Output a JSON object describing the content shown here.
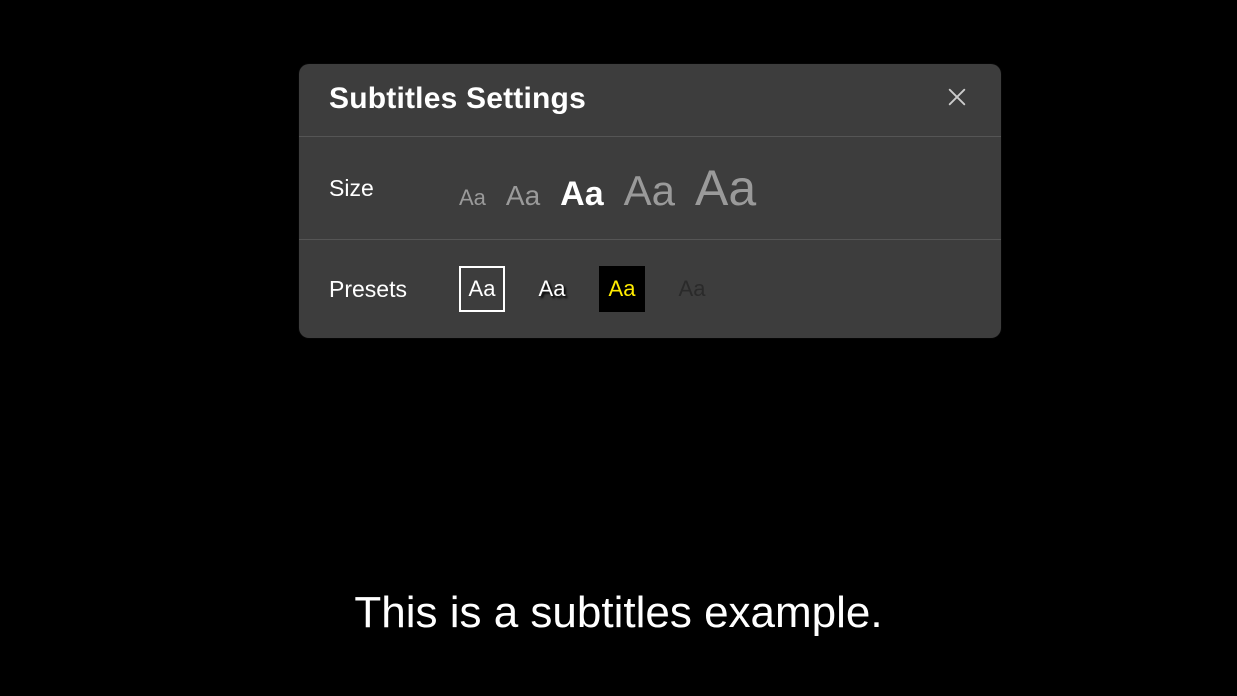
{
  "panel": {
    "title": "Subtitles Settings"
  },
  "size": {
    "label": "Size",
    "glyph": "Aa",
    "options": [
      {
        "selected": false
      },
      {
        "selected": false
      },
      {
        "selected": true
      },
      {
        "selected": false
      },
      {
        "selected": false
      }
    ]
  },
  "presets": {
    "label": "Presets",
    "glyph": "Aa",
    "options": [
      {
        "style": "white-on-transparent-bordered",
        "selected": true
      },
      {
        "style": "white-shadow",
        "selected": false
      },
      {
        "style": "yellow-on-black",
        "selected": false
      },
      {
        "style": "dark-on-transparent",
        "selected": false
      }
    ]
  },
  "subtitle_example": "This is a subtitles example."
}
